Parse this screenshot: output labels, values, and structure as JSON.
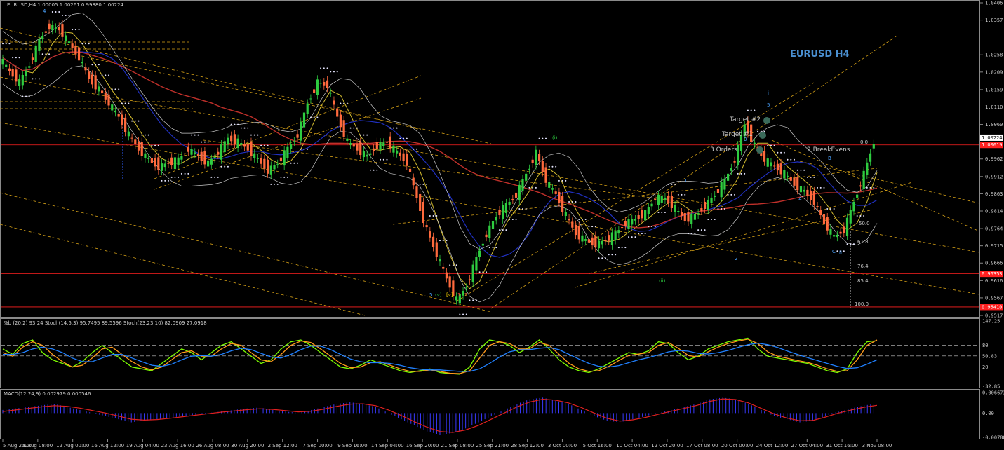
{
  "chart_data": [
    {
      "type": "candlestick",
      "symbol_header": "EURUSD,H4  1.00005 1.00261 0.99880 1.00224",
      "title": "EURUSD H4",
      "ylim": [
        0.9517,
        1.0406
      ],
      "y_ticks": [
        "1.0406",
        "1.0357",
        "1.0258",
        "1.0209",
        "1.0159",
        "1.0110",
        "1.0060",
        "0.9962",
        "0.9912",
        "0.9863",
        "0.9814",
        "0.9764",
        "0.9715",
        "0.9666",
        "0.9616",
        "0.9567",
        "0.9517"
      ],
      "x_ticks": [
        "5 Aug 2022",
        "9 Aug 08:00",
        "12 Aug 00:00",
        "16 Aug 12:00",
        "19 Aug 04:00",
        "23 Aug 16:00",
        "26 Aug 08:00",
        "30 Aug 20:00",
        "2 Sep 12:00",
        "7 Sep 00:00",
        "9 Sep 16:00",
        "14 Sep 04:00",
        "16 Sep 20:00",
        "21 Sep 08:00",
        "25 Sep 21:00",
        "28 Sep 12:00",
        "3 Oct 00:00",
        "5 Oct 16:00",
        "10 Oct 04:00",
        "12 Oct 20:00",
        "17 Oct 08:00",
        "20 Oct 00:00",
        "24 Oct 12:00",
        "27 Oct 04:00",
        "31 Oct 16:00",
        "3 Nov 08:00"
      ],
      "price_close_series": [
        1.025,
        1.021,
        1.018,
        1.023,
        1.03,
        1.034,
        1.033,
        1.029,
        1.025,
        1.019,
        1.016,
        1.012,
        1.008,
        1.003,
        0.999,
        0.996,
        0.994,
        0.995,
        0.996,
        0.999,
        0.997,
        0.995,
        0.998,
        1.002,
        1.001,
        0.999,
        0.996,
        0.993,
        0.995,
        0.999,
        1.003,
        1.012,
        1.018,
        1.017,
        1.008,
        1.001,
        0.999,
        0.997,
        1.0,
        1.001,
        0.998,
        0.995,
        0.985,
        0.976,
        0.969,
        0.962,
        0.956,
        0.96,
        0.968,
        0.975,
        0.98,
        0.983,
        0.986,
        0.992,
        0.998,
        0.99,
        0.986,
        0.98,
        0.975,
        0.973,
        0.972,
        0.973,
        0.975,
        0.978,
        0.979,
        0.981,
        0.985,
        0.985,
        0.982,
        0.979,
        0.98,
        0.983,
        0.986,
        0.99,
        0.996,
        1.006,
        1.0,
        0.996,
        0.994,
        0.992,
        0.989,
        0.987,
        0.984,
        0.978,
        0.974,
        0.976,
        0.984,
        0.992,
        1.001
      ],
      "price_labels": [
        {
          "text": "1.00224",
          "value": 1.00224,
          "color": "#000000",
          "bg": "#ffffff"
        },
        {
          "text": "1.00019",
          "value": 1.00019,
          "color": "#ffffff",
          "bg": "#ff2020"
        },
        {
          "text": "0.96353",
          "value": 0.96353,
          "color": "#ffffff",
          "bg": "#ff2020"
        },
        {
          "text": "0.95410",
          "value": 0.9541,
          "color": "#ffffff",
          "bg": "#ff2020"
        }
      ],
      "horizontal_lines": [
        {
          "value": 1.00019,
          "color": "#ff2020"
        },
        {
          "value": 0.96353,
          "color": "#ff2020"
        },
        {
          "value": 0.9541,
          "color": "#ff2020"
        }
      ],
      "annotations": [
        {
          "text": "Target #2",
          "color": "#c8c8c8"
        },
        {
          "text": "Target #1",
          "color": "#c8c8c8"
        },
        {
          "text": "3 Orders",
          "color": "#c8c8c8"
        },
        {
          "text": "2 BreakEvens",
          "color": "#c8c8c8"
        },
        {
          "text": "4",
          "color": "#4aa3ff"
        },
        {
          "text": "5",
          "color": "#4aa3ff"
        },
        {
          "text": "3",
          "color": "#4aa3ff"
        },
        {
          "text": "1",
          "color": "#4aa3ff"
        },
        {
          "text": "2",
          "color": "#4aa3ff"
        },
        {
          "text": "A",
          "color": "#4aa3ff"
        },
        {
          "text": "B",
          "color": "#4aa3ff"
        },
        {
          "text": "C",
          "color": "#4aa3ff"
        },
        {
          "text": "ii",
          "color": "#4aa3ff"
        },
        {
          "text": "i",
          "color": "#4aa3ff"
        },
        {
          "text": "(i)",
          "color": "#2ecc40"
        },
        {
          "text": "(ii)",
          "color": "#2ecc40"
        },
        {
          "text": "5",
          "color": "#4aa3ff"
        },
        {
          "text": "(v)",
          "color": "#2ecc40"
        },
        {
          "text": "[v]",
          "color": "#ffd700"
        },
        {
          "text": "1",
          "color": "#ff4040"
        },
        {
          "text": "?",
          "color": "#ff8040"
        },
        {
          "text": "0.0",
          "color": "#c8c8c8"
        },
        {
          "text": "50.0",
          "color": "#c8c8c8"
        },
        {
          "text": "61.8",
          "color": "#c8c8c8"
        },
        {
          "text": "76.4",
          "color": "#c8c8c8"
        },
        {
          "text": "85.4",
          "color": "#c8c8c8"
        },
        {
          "text": "100.0",
          "color": "#c8c8c8"
        }
      ],
      "colors": {
        "bull": "#2ecc40",
        "bear": "#ff6a3d",
        "ma_red": "#c0302a",
        "ma_blue": "#2030c0",
        "ma_yellow": "#d8c030",
        "band": "#c8c8c8",
        "sar": "#e6e6ff",
        "channel": "#d4a017"
      }
    },
    {
      "type": "line",
      "header": "%b (20,2) 93.24  Stoch(14,5,3) 95.7495 89.5596  Stoch(23,23,10) 82.0909 27.0918",
      "y_ticks": [
        "147.25",
        "80",
        "50.83",
        "20",
        "-32.85"
      ],
      "series": [
        {
          "name": "%b (20,2)",
          "color": "#7cfc00",
          "values": [
            70,
            55,
            85,
            95,
            60,
            40,
            30,
            20,
            35,
            60,
            80,
            60,
            40,
            20,
            15,
            10,
            30,
            50,
            70,
            60,
            40,
            60,
            80,
            90,
            70,
            50,
            30,
            40,
            70,
            90,
            95,
            80,
            60,
            40,
            20,
            15,
            25,
            40,
            30,
            20,
            10,
            5,
            10,
            15,
            5,
            2,
            0,
            20,
            70,
            95,
            90,
            80,
            60,
            75,
            95,
            70,
            40,
            20,
            10,
            5,
            15,
            30,
            45,
            60,
            55,
            65,
            90,
            85,
            60,
            40,
            50,
            70,
            80,
            90,
            95,
            100,
            70,
            50,
            45,
            40,
            35,
            30,
            20,
            10,
            5,
            15,
            60,
            90,
            93
          ]
        },
        {
          "name": "Stoch(14,5,3)",
          "color": "#ff9a1a",
          "values": [
            60,
            50,
            75,
            90,
            80,
            55,
            35,
            20,
            25,
            45,
            70,
            75,
            55,
            35,
            20,
            12,
            20,
            40,
            60,
            65,
            50,
            50,
            70,
            85,
            80,
            60,
            40,
            35,
            55,
            80,
            92,
            88,
            70,
            50,
            30,
            18,
            20,
            32,
            35,
            25,
            15,
            8,
            8,
            12,
            8,
            3,
            2,
            10,
            45,
            80,
            90,
            85,
            70,
            70,
            88,
            80,
            55,
            30,
            15,
            8,
            10,
            22,
            38,
            52,
            56,
            60,
            80,
            88,
            72,
            52,
            48,
            62,
            75,
            85,
            92,
            97,
            85,
            62,
            50,
            44,
            38,
            33,
            25,
            15,
            8,
            10,
            40,
            80,
            95
          ]
        },
        {
          "name": "Stoch(23,23,10)",
          "color": "#2080ff",
          "values": [
            55,
            55,
            60,
            70,
            75,
            70,
            60,
            45,
            35,
            35,
            45,
            55,
            55,
            45,
            35,
            25,
            22,
            28,
            40,
            50,
            52,
            50,
            55,
            65,
            72,
            68,
            58,
            48,
            45,
            55,
            68,
            78,
            78,
            68,
            55,
            42,
            35,
            32,
            32,
            30,
            25,
            18,
            14,
            12,
            12,
            10,
            8,
            8,
            15,
            30,
            48,
            62,
            68,
            68,
            72,
            74,
            68,
            55,
            42,
            30,
            22,
            20,
            24,
            32,
            40,
            46,
            54,
            62,
            66,
            64,
            58,
            56,
            60,
            66,
            74,
            82,
            86,
            82,
            74,
            64,
            55,
            46,
            38,
            30,
            22,
            16,
            18,
            28,
            40
          ]
        }
      ]
    },
    {
      "type": "bar",
      "header": "MACD(12,24,9) 0.002979 0.000546",
      "y_ticks": [
        "0.006673",
        "0.00",
        "-0.007888"
      ],
      "series": [
        {
          "name": "MACD",
          "color": "#3a3aff",
          "values": [
            0.001,
            0.0015,
            0.002,
            0.0025,
            0.003,
            0.002,
            0.001,
            0.0,
            -0.001,
            -0.002,
            -0.003,
            -0.0025,
            -0.002,
            -0.0015,
            -0.001,
            -0.0005,
            0.0,
            0.0005,
            0.001,
            0.0015,
            0.0018,
            0.001,
            0.0005,
            0.0,
            0.001,
            0.002,
            0.003,
            0.0035,
            0.003,
            0.002,
            0.0,
            -0.002,
            -0.004,
            -0.006,
            -0.007,
            -0.0065,
            -0.005,
            -0.003,
            -0.001,
            0.001,
            0.003,
            0.0045,
            0.005,
            0.004,
            0.003,
            0.001,
            -0.001,
            -0.0025,
            -0.003,
            -0.002,
            -0.001,
            0.0,
            0.001,
            0.002,
            0.003,
            0.0045,
            0.005,
            0.0045,
            0.003,
            0.001,
            -0.001,
            -0.002,
            -0.003,
            -0.0025,
            -0.001,
            0.0005,
            0.0015,
            0.0025,
            0.003
          ]
        },
        {
          "name": "Signal",
          "color": "#e02020",
          "values": [
            0.0005,
            0.001,
            0.0015,
            0.002,
            0.0024,
            0.0022,
            0.0016,
            0.0008,
            0.0,
            -0.001,
            -0.002,
            -0.0023,
            -0.0021,
            -0.0017,
            -0.0012,
            -0.0007,
            -0.0002,
            0.0003,
            0.0007,
            0.0011,
            0.0014,
            0.0012,
            0.0008,
            0.0004,
            0.0006,
            0.0013,
            0.0022,
            0.0029,
            0.003,
            0.0024,
            0.001,
            -0.0008,
            -0.0028,
            -0.0046,
            -0.006,
            -0.0063,
            -0.0055,
            -0.004,
            -0.002,
            0.0,
            0.002,
            0.0036,
            0.0045,
            0.0042,
            0.0033,
            0.0018,
            0.0,
            -0.0017,
            -0.0026,
            -0.0022,
            -0.0014,
            -0.0004,
            0.0006,
            0.0015,
            0.0025,
            0.0038,
            0.0046,
            0.0044,
            0.0033,
            0.0015,
            -0.0003,
            -0.0016,
            -0.0025,
            -0.0024,
            -0.0013,
            0.0,
            0.001,
            0.0019,
            0.0025
          ]
        }
      ]
    }
  ]
}
